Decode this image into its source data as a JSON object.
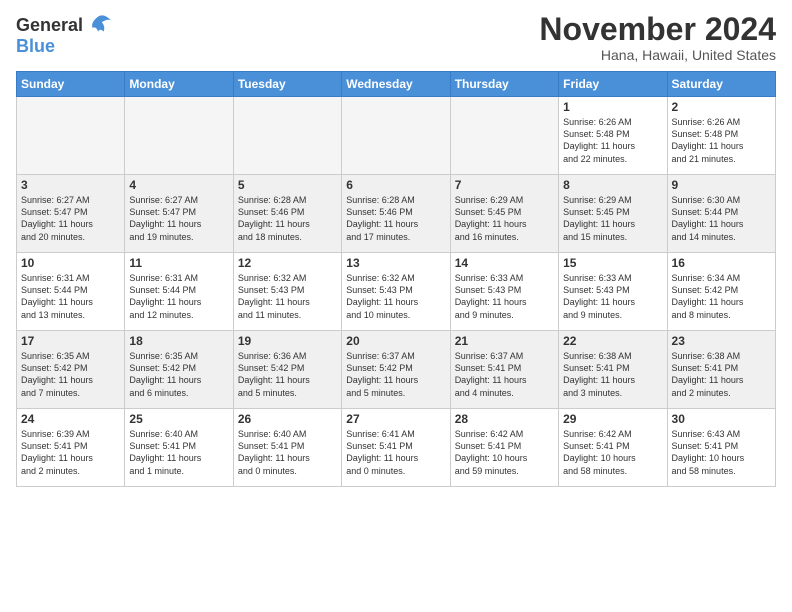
{
  "logo": {
    "text_general": "General",
    "text_blue": "Blue"
  },
  "title": "November 2024",
  "location": "Hana, Hawaii, United States",
  "weekdays": [
    "Sunday",
    "Monday",
    "Tuesday",
    "Wednesday",
    "Thursday",
    "Friday",
    "Saturday"
  ],
  "weeks": [
    [
      {
        "day": "",
        "info": ""
      },
      {
        "day": "",
        "info": ""
      },
      {
        "day": "",
        "info": ""
      },
      {
        "day": "",
        "info": ""
      },
      {
        "day": "",
        "info": ""
      },
      {
        "day": "1",
        "info": "Sunrise: 6:26 AM\nSunset: 5:48 PM\nDaylight: 11 hours\nand 22 minutes."
      },
      {
        "day": "2",
        "info": "Sunrise: 6:26 AM\nSunset: 5:48 PM\nDaylight: 11 hours\nand 21 minutes."
      }
    ],
    [
      {
        "day": "3",
        "info": "Sunrise: 6:27 AM\nSunset: 5:47 PM\nDaylight: 11 hours\nand 20 minutes."
      },
      {
        "day": "4",
        "info": "Sunrise: 6:27 AM\nSunset: 5:47 PM\nDaylight: 11 hours\nand 19 minutes."
      },
      {
        "day": "5",
        "info": "Sunrise: 6:28 AM\nSunset: 5:46 PM\nDaylight: 11 hours\nand 18 minutes."
      },
      {
        "day": "6",
        "info": "Sunrise: 6:28 AM\nSunset: 5:46 PM\nDaylight: 11 hours\nand 17 minutes."
      },
      {
        "day": "7",
        "info": "Sunrise: 6:29 AM\nSunset: 5:45 PM\nDaylight: 11 hours\nand 16 minutes."
      },
      {
        "day": "8",
        "info": "Sunrise: 6:29 AM\nSunset: 5:45 PM\nDaylight: 11 hours\nand 15 minutes."
      },
      {
        "day": "9",
        "info": "Sunrise: 6:30 AM\nSunset: 5:44 PM\nDaylight: 11 hours\nand 14 minutes."
      }
    ],
    [
      {
        "day": "10",
        "info": "Sunrise: 6:31 AM\nSunset: 5:44 PM\nDaylight: 11 hours\nand 13 minutes."
      },
      {
        "day": "11",
        "info": "Sunrise: 6:31 AM\nSunset: 5:44 PM\nDaylight: 11 hours\nand 12 minutes."
      },
      {
        "day": "12",
        "info": "Sunrise: 6:32 AM\nSunset: 5:43 PM\nDaylight: 11 hours\nand 11 minutes."
      },
      {
        "day": "13",
        "info": "Sunrise: 6:32 AM\nSunset: 5:43 PM\nDaylight: 11 hours\nand 10 minutes."
      },
      {
        "day": "14",
        "info": "Sunrise: 6:33 AM\nSunset: 5:43 PM\nDaylight: 11 hours\nand 9 minutes."
      },
      {
        "day": "15",
        "info": "Sunrise: 6:33 AM\nSunset: 5:43 PM\nDaylight: 11 hours\nand 9 minutes."
      },
      {
        "day": "16",
        "info": "Sunrise: 6:34 AM\nSunset: 5:42 PM\nDaylight: 11 hours\nand 8 minutes."
      }
    ],
    [
      {
        "day": "17",
        "info": "Sunrise: 6:35 AM\nSunset: 5:42 PM\nDaylight: 11 hours\nand 7 minutes."
      },
      {
        "day": "18",
        "info": "Sunrise: 6:35 AM\nSunset: 5:42 PM\nDaylight: 11 hours\nand 6 minutes."
      },
      {
        "day": "19",
        "info": "Sunrise: 6:36 AM\nSunset: 5:42 PM\nDaylight: 11 hours\nand 5 minutes."
      },
      {
        "day": "20",
        "info": "Sunrise: 6:37 AM\nSunset: 5:42 PM\nDaylight: 11 hours\nand 5 minutes."
      },
      {
        "day": "21",
        "info": "Sunrise: 6:37 AM\nSunset: 5:41 PM\nDaylight: 11 hours\nand 4 minutes."
      },
      {
        "day": "22",
        "info": "Sunrise: 6:38 AM\nSunset: 5:41 PM\nDaylight: 11 hours\nand 3 minutes."
      },
      {
        "day": "23",
        "info": "Sunrise: 6:38 AM\nSunset: 5:41 PM\nDaylight: 11 hours\nand 2 minutes."
      }
    ],
    [
      {
        "day": "24",
        "info": "Sunrise: 6:39 AM\nSunset: 5:41 PM\nDaylight: 11 hours\nand 2 minutes."
      },
      {
        "day": "25",
        "info": "Sunrise: 6:40 AM\nSunset: 5:41 PM\nDaylight: 11 hours\nand 1 minute."
      },
      {
        "day": "26",
        "info": "Sunrise: 6:40 AM\nSunset: 5:41 PM\nDaylight: 11 hours\nand 0 minutes."
      },
      {
        "day": "27",
        "info": "Sunrise: 6:41 AM\nSunset: 5:41 PM\nDaylight: 11 hours\nand 0 minutes."
      },
      {
        "day": "28",
        "info": "Sunrise: 6:42 AM\nSunset: 5:41 PM\nDaylight: 10 hours\nand 59 minutes."
      },
      {
        "day": "29",
        "info": "Sunrise: 6:42 AM\nSunset: 5:41 PM\nDaylight: 10 hours\nand 58 minutes."
      },
      {
        "day": "30",
        "info": "Sunrise: 6:43 AM\nSunset: 5:41 PM\nDaylight: 10 hours\nand 58 minutes."
      }
    ]
  ]
}
